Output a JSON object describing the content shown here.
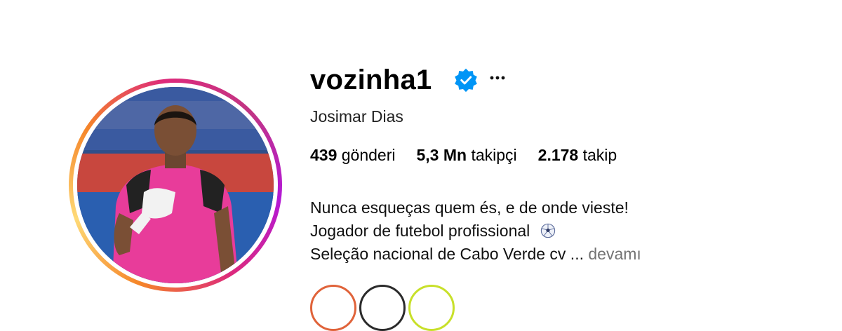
{
  "profile": {
    "username": "vozinha1",
    "full_name": "Josimar Dias",
    "verified": true,
    "verified_icon": "verified-badge-icon",
    "more_icon": "more-options-icon",
    "ring_colors": [
      "#f58529",
      "#feda77",
      "#dd2a7b",
      "#b318d6"
    ]
  },
  "stats": {
    "posts_value": "439",
    "posts_label": "gönderi",
    "followers_value": "5,3 Mn",
    "followers_label": "takipçi",
    "following_value": "2.178",
    "following_label": "takip"
  },
  "bio": {
    "line1": "Nunca esqueças quem és, e de onde vieste!",
    "line2": "Jogador de futebol profissional",
    "line2_emoji": "soccer-ball-icon",
    "line3": "Seleção nacional de Cabo Verde cv ...",
    "more_label": "devamı"
  },
  "highlights": [
    {
      "color": "#e0633a"
    },
    {
      "color": "#2b2b2b"
    },
    {
      "color": "#c8e02a"
    }
  ]
}
